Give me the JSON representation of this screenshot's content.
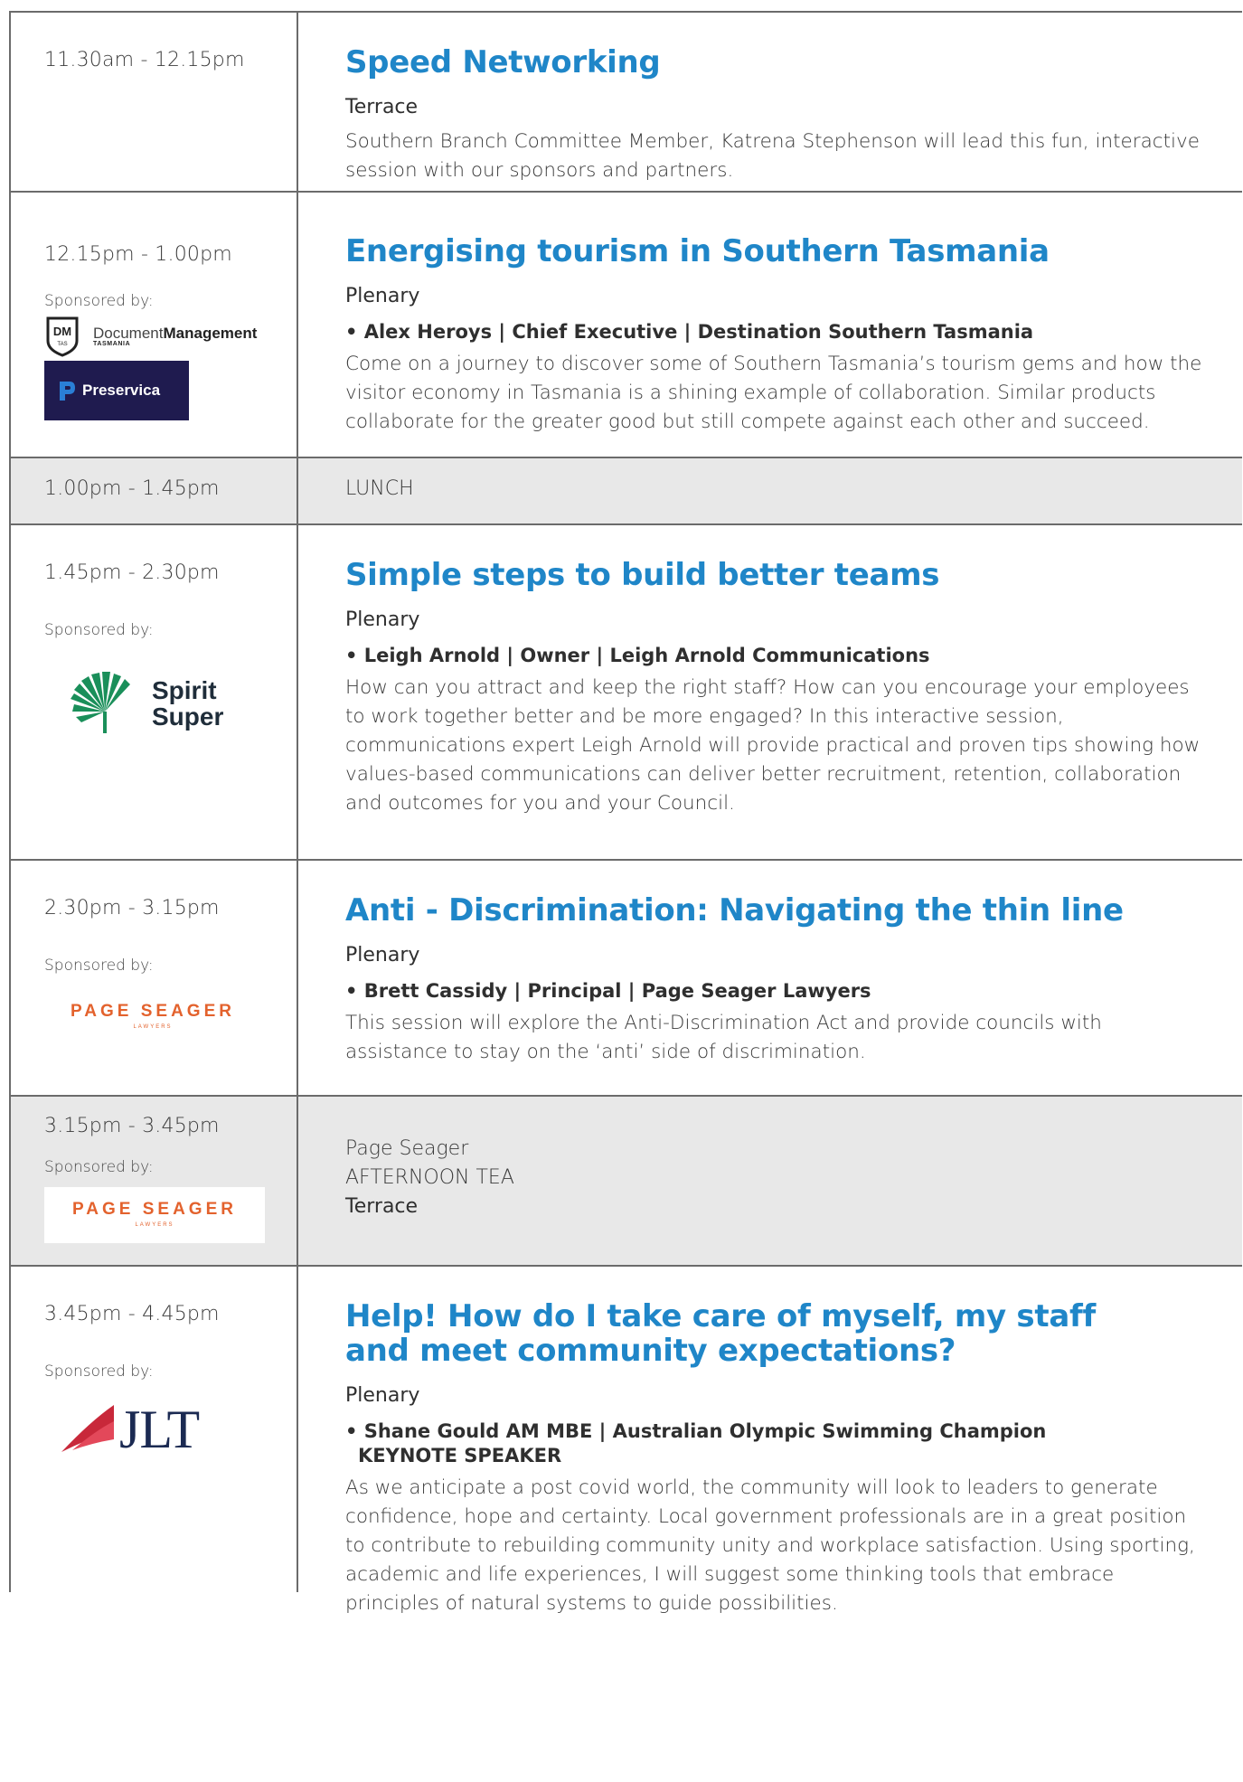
{
  "rows": [
    {
      "time": "11.30am - 12.15pm",
      "title": "Speed Networking",
      "venue": "Terrace",
      "description": "Southern Branch Committee Member, Katrena Stephenson will lead this fun, interactive session with our sponsors and partners."
    },
    {
      "time": "12.15pm - 1.00pm",
      "sponsored_label": "Sponsored by:",
      "sponsors": [
        {
          "badge": "DM",
          "badge_sub": "TAS",
          "name_light": "Document",
          "name_bold": "Management",
          "sub": "TASMANIA"
        },
        {
          "name": "Preservica",
          "color": "#1f1b4f"
        }
      ],
      "title": "Energising tourism in Southern Tasmania",
      "venue": "Plenary",
      "speaker": "• Alex Heroys  |  Chief Executive  |  Destination Southern Tasmania",
      "description": "Come on a journey to discover some of Southern Tasmania’s tourism gems and how the visitor economy in Tasmania is a shining example of collaboration. Similar products collaborate for the greater good but still compete against each other and succeed."
    },
    {
      "time": "1.00pm - 1.45pm",
      "label": "LUNCH"
    },
    {
      "time": "1.45pm - 2.30pm",
      "sponsored_label": "Sponsored by:",
      "sponsor": {
        "line1": "Spirit",
        "line2": "Super",
        "color": "#1a8f5a"
      },
      "title": "Simple steps to build better teams",
      "venue": "Plenary",
      "speaker": "• Leigh Arnold  |  Owner  |  Leigh Arnold Communications",
      "description": "How can you attract and keep the right staff? How can you encourage your employees to work together better and be more engaged? In this interactive session, communications expert Leigh Arnold will provide practical and proven tips showing how values-based communications can deliver better recruitment, retention, collaboration and outcomes for you and your Council."
    },
    {
      "time": "2.30pm - 3.15pm",
      "sponsored_label": "Sponsored by:",
      "sponsor": {
        "name": "PAGE SEAGER",
        "sub": "LAWYERS",
        "color": "#e3622d"
      },
      "title": "Anti - Discrimination: Navigating the thin line",
      "venue": "Plenary",
      "speaker": "• Brett Cassidy  |  Principal  |  Page Seager Lawyers",
      "description": "This session will explore the Anti-Discrimination Act and provide councils with assistance to stay on the ‘anti’ side of discrimination."
    },
    {
      "time": "3.15pm - 3.45pm",
      "sponsored_label": "Sponsored by:",
      "sponsor": {
        "name": "PAGE SEAGER",
        "sub": "LAWYERS"
      },
      "line1": "Page Seager",
      "line2": "AFTERNOON TEA",
      "line3": "Terrace"
    },
    {
      "time": "3.45pm - 4.45pm",
      "sponsored_label": "Sponsored by:",
      "sponsor": {
        "name": "JLT",
        "color": "#c8283a"
      },
      "title": "Help! How do I take care of myself, my staff and meet community expectations?",
      "venue": "Plenary",
      "speaker": "• Shane Gould AM MBE  |  Australian Olympic Swimming Champion",
      "speaker2": "KEYNOTE SPEAKER",
      "description": "As we anticipate a post covid world, the community will look to leaders to generate confidence, hope and certainty. Local government professionals are in a great position to contribute to rebuilding community unity and workplace satisfaction. Using sporting, academic and life experiences, I will suggest some thinking tools that embrace principles of natural systems to guide possibilities."
    }
  ]
}
